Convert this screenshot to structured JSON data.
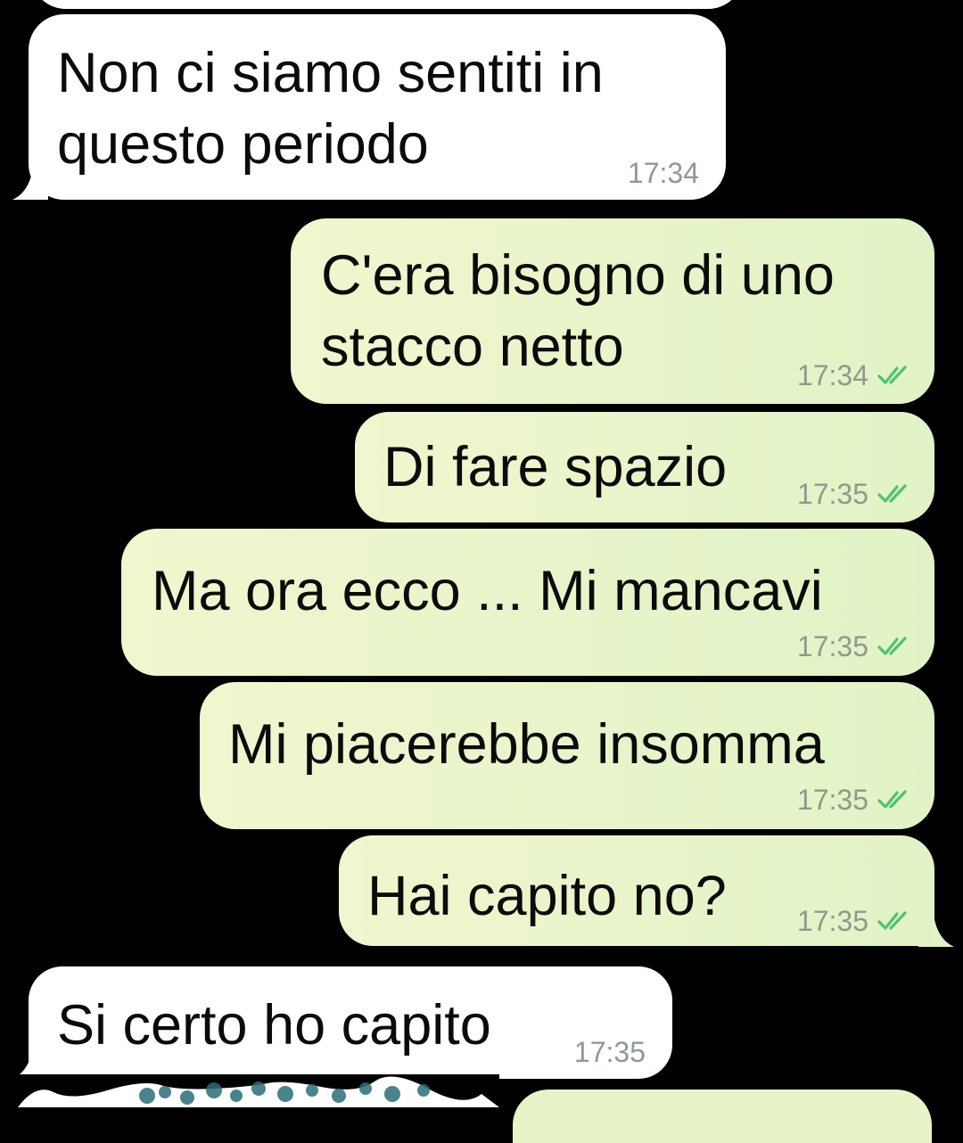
{
  "chat": {
    "messages": [
      {
        "direction": "incoming",
        "text": "Non ci siamo sentiti in\nquesto periodo",
        "time": "17:34"
      },
      {
        "direction": "outgoing",
        "text": "C'era bisogno di uno\nstacco netto",
        "time": "17:34",
        "status": "read"
      },
      {
        "direction": "outgoing",
        "text": "Di fare spazio",
        "time": "17:35",
        "status": "read"
      },
      {
        "direction": "outgoing",
        "text": "Ma ora ecco ... Mi mancavi",
        "time": "17:35",
        "status": "read"
      },
      {
        "direction": "outgoing",
        "text": "Mi piacerebbe insomma",
        "time": "17:35",
        "status": "read"
      },
      {
        "direction": "outgoing",
        "text": "Hai capito no?",
        "time": "17:35",
        "status": "read"
      },
      {
        "direction": "incoming",
        "text": "Si certo ho capito",
        "time": "17:35"
      }
    ]
  },
  "colors": {
    "background": "#000000",
    "incoming_bubble": "#ffffff",
    "outgoing_bubble": "#e4f4c8",
    "read_check": "#4fc36b",
    "timestamp": "#8e9a8e"
  }
}
